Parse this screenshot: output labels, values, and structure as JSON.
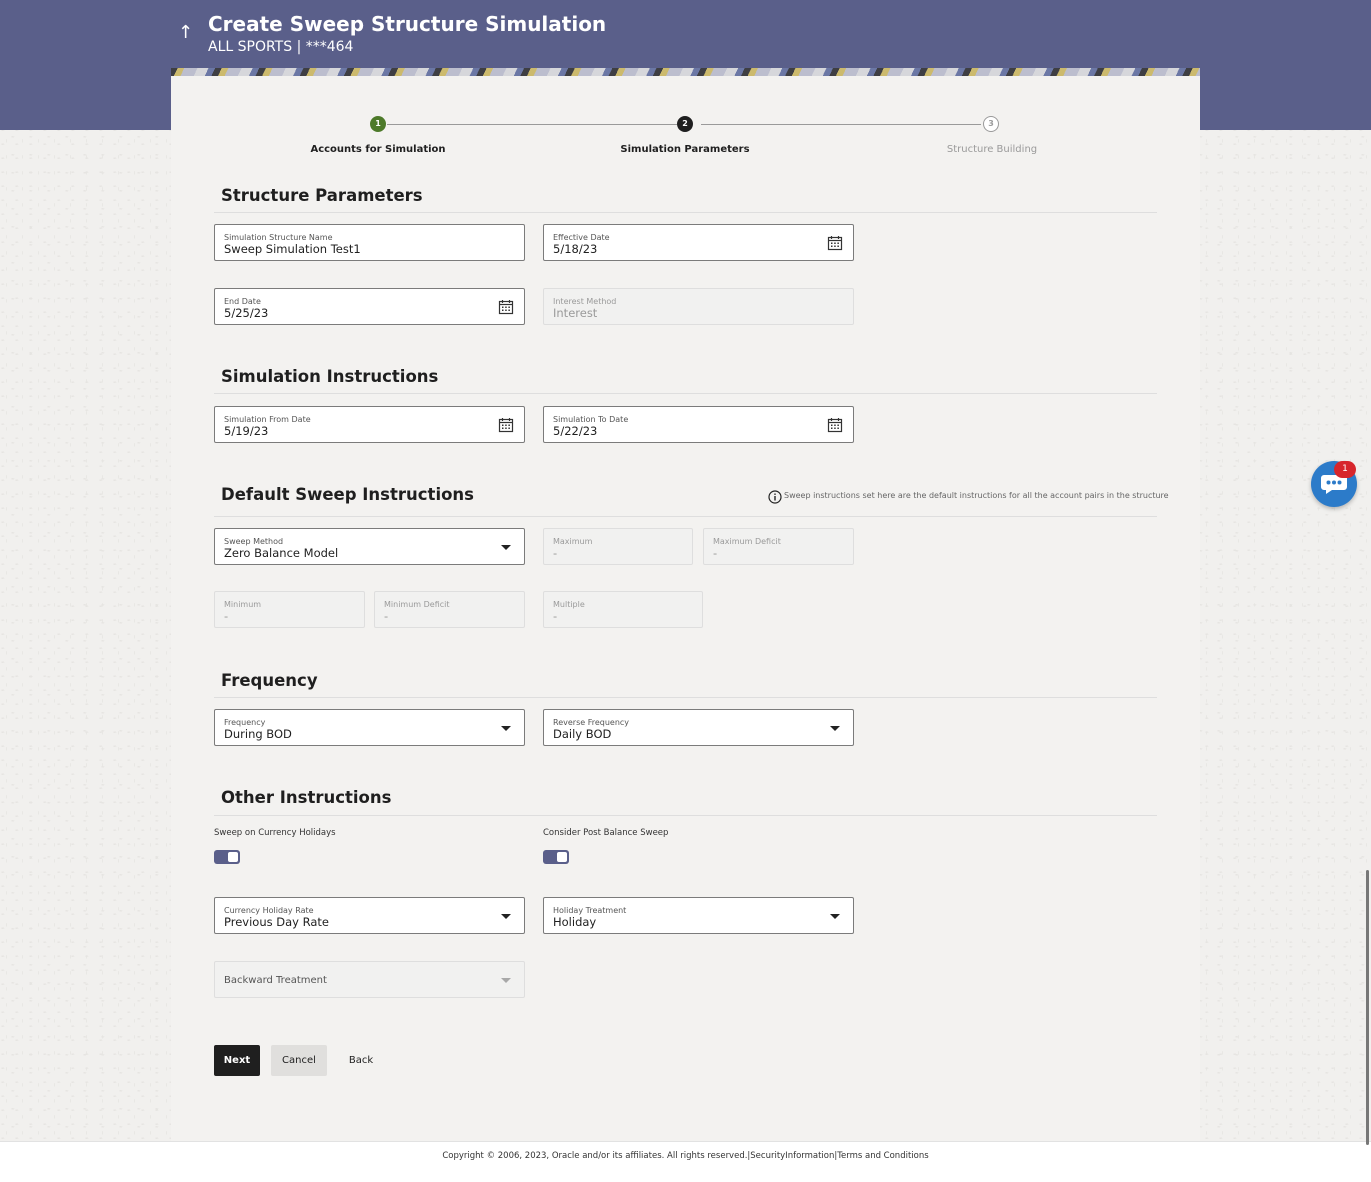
{
  "header": {
    "title": "Create Sweep Structure Simulation",
    "subtitle": "ALL SPORTS | ***464",
    "back_icon": "arrow-up-icon"
  },
  "stepper": {
    "steps": [
      {
        "number": "1",
        "label": "Accounts for Simulation",
        "state": "completed",
        "color": "#4d7a2a"
      },
      {
        "number": "2",
        "label": "Simulation Parameters",
        "state": "active",
        "color": "#1f1f1f"
      },
      {
        "number": "3",
        "label": "Structure Building",
        "state": "pending",
        "color": "#9a9a9a"
      }
    ]
  },
  "structure_parameters": {
    "title": "Structure Parameters",
    "simulation_name": {
      "label": "Simulation Structure Name",
      "value": "Sweep Simulation Test1"
    },
    "effective_date": {
      "label": "Effective Date",
      "value": "5/18/23"
    },
    "end_date": {
      "label": "End Date",
      "value": "5/25/23"
    },
    "interest_method": {
      "label": "Interest Method",
      "value": "Interest"
    }
  },
  "simulation_instructions": {
    "title": "Simulation Instructions",
    "from_date": {
      "label": "Simulation From Date",
      "value": "5/19/23"
    },
    "to_date": {
      "label": "Simulation To Date",
      "value": "5/22/23"
    }
  },
  "default_sweep": {
    "title": "Default Sweep Instructions",
    "note": "Sweep instructions set here are the default instructions for all the account pairs in the structure",
    "sweep_method": {
      "label": "Sweep Method",
      "value": "Zero Balance Model"
    },
    "maximum": {
      "label": "Maximum",
      "value": "-"
    },
    "maximum_deficit": {
      "label": "Maximum Deficit",
      "value": "-"
    },
    "minimum": {
      "label": "Minimum",
      "value": "-"
    },
    "minimum_deficit": {
      "label": "Minimum Deficit",
      "value": "-"
    },
    "multiple": {
      "label": "Multiple",
      "value": "-"
    }
  },
  "frequency": {
    "title": "Frequency",
    "frequency": {
      "label": "Frequency",
      "value": "During BOD"
    },
    "reverse_frequency": {
      "label": "Reverse Frequency",
      "value": "Daily BOD"
    }
  },
  "other_instructions": {
    "title": "Other Instructions",
    "sweep_on_holidays": {
      "label": "Sweep on Currency Holidays",
      "on": true
    },
    "post_balance_sweep": {
      "label": "Consider Post Balance Sweep",
      "on": true
    },
    "currency_holiday_rate": {
      "label": "Currency Holiday Rate",
      "value": "Previous Day Rate"
    },
    "holiday_treatment": {
      "label": "Holiday Treatment",
      "value": "Holiday"
    },
    "backward_treatment": {
      "label": "Backward Treatment"
    }
  },
  "actions": {
    "next": "Next",
    "cancel": "Cancel",
    "back": "Back"
  },
  "chat": {
    "badge": "1"
  },
  "footer": {
    "text": "Copyright © 2006, 2023, Oracle and/or its affiliates. All rights reserved.|SecurityInformation|Terms and Conditions"
  }
}
